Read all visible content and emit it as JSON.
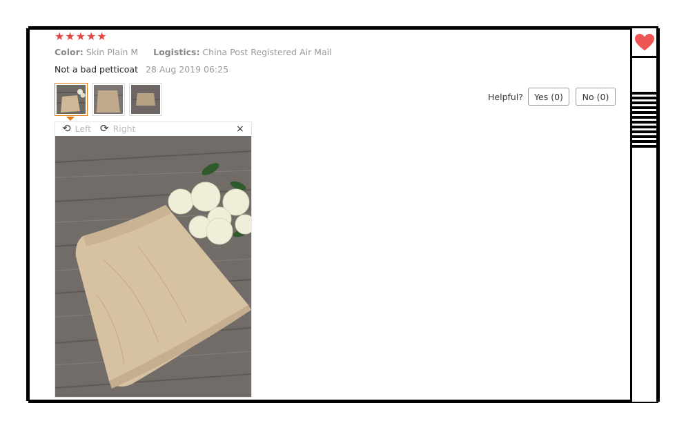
{
  "review": {
    "rating": 5,
    "stars": [
      "★",
      "★",
      "★",
      "★",
      "★"
    ],
    "color_key": "Color:",
    "color_value": "Skin Plain M",
    "logistics_key": "Logistics:",
    "logistics_value": "China Post Registered Air Mail",
    "feedback_text": "Not a bad petticoat",
    "date": "28 Aug 2019 06:25"
  },
  "helpful": {
    "label": "Helpful?",
    "yes_label": "Yes (0)",
    "no_label": "No (0)"
  },
  "viewer": {
    "rotate_left_label": "Left",
    "rotate_right_label": "Right",
    "close_label": "×"
  },
  "thumbnails": [
    {
      "selected": true
    },
    {
      "selected": false
    },
    {
      "selected": false
    }
  ],
  "colors": {
    "star": "#e64545",
    "accent": "#e47911",
    "heart": "#f05555"
  },
  "icons": {
    "heart": "heart-icon",
    "rotate_left": "rotate-left-icon",
    "rotate_right": "rotate-right-icon",
    "close": "close-icon"
  }
}
